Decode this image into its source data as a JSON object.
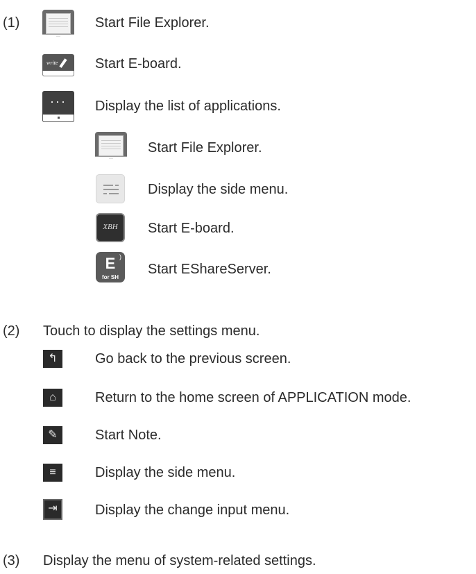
{
  "section1": {
    "number": "(1)",
    "items": [
      {
        "icon": "file-explorer-icon",
        "text": "Start File Explorer."
      },
      {
        "icon": "write-icon",
        "text": "Start E-board."
      },
      {
        "icon": "more-apps-icon",
        "text": "Display the list of applications."
      }
    ],
    "sub_items": [
      {
        "icon": "file-explorer-icon",
        "text": "Start File Explorer."
      },
      {
        "icon": "side-menu-icon",
        "text": "Display the side menu."
      },
      {
        "icon": "eboard-icon",
        "text": "Start E-board."
      },
      {
        "icon": "eshare-icon",
        "text": "Start EShareServer."
      }
    ],
    "write_icon_label": "write",
    "eboard_icon_label": "XBH",
    "eshare_icon_letter": "E",
    "eshare_icon_label": "for SH"
  },
  "section2": {
    "number": "(2)",
    "heading": "Touch to display the settings menu.",
    "items": [
      {
        "icon": "back-icon",
        "text": "Go back to the previous screen."
      },
      {
        "icon": "home-icon",
        "text": "Return to the home screen of APPLICATION mode."
      },
      {
        "icon": "note-icon",
        "text": "Start Note."
      },
      {
        "icon": "side-menu-icon",
        "text": "Display the side menu."
      },
      {
        "icon": "input-icon",
        "text": "Display the change input menu."
      }
    ]
  },
  "section3": {
    "number": "(3)",
    "heading": "Display the menu of system-related settings."
  }
}
